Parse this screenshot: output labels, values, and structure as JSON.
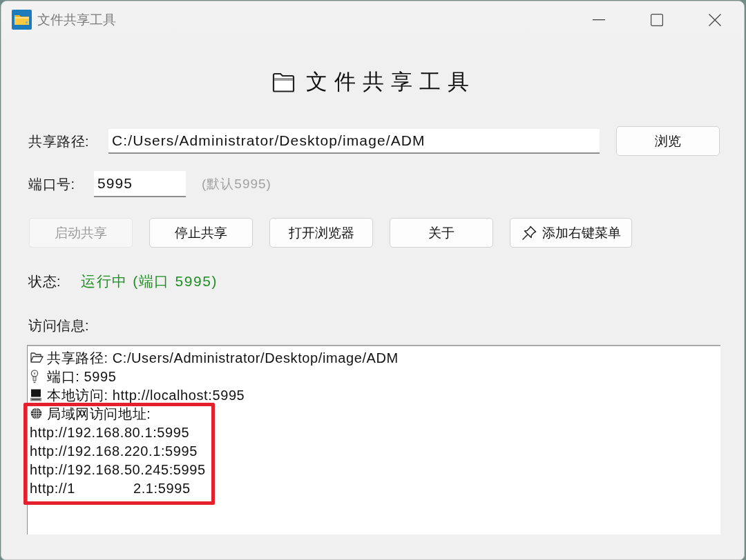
{
  "window": {
    "title": "文件共享工具"
  },
  "heading": "文件共享工具",
  "form": {
    "path": {
      "label": "共享路径:",
      "value": "C:/Users/Administrator/Desktop/image/ADM",
      "button": "浏览"
    },
    "port": {
      "label": "端口号:",
      "value": "5995",
      "hint": "(默认5995)"
    }
  },
  "actions": [
    {
      "label": "启动共享",
      "disabled": true,
      "kind": "text"
    },
    {
      "label": "停止共享",
      "disabled": false,
      "kind": "text"
    },
    {
      "label": "打开浏览器",
      "disabled": false,
      "kind": "text"
    },
    {
      "label": "关于",
      "disabled": false,
      "kind": "text"
    },
    {
      "label": "添加右键菜单",
      "disabled": false,
      "kind": "icon"
    }
  ],
  "status": {
    "label": "状态:",
    "value": "运行中 (端口 5995)",
    "running": true
  },
  "access": {
    "label": "访问信息:",
    "lines": [
      {
        "kind": "path",
        "text": "共享路径: C:/Users/Administrator/Desktop/image/ADM"
      },
      {
        "kind": "port",
        "text": "端口: 5995"
      },
      {
        "kind": "local",
        "text": "本地访问: http://localhost:5995"
      }
    ],
    "lan": {
      "highlighted": true,
      "heading": "局域网访问地址:",
      "urls": [
        {
          "text": "http://192.168.80.1:5995"
        },
        {
          "text": "http://192.168.220.1:5995"
        },
        {
          "text": "http://192.168.50.245:5995"
        },
        {
          "text": "http://1",
          "after_redaction": "2.1:5995"
        }
      ]
    }
  }
}
